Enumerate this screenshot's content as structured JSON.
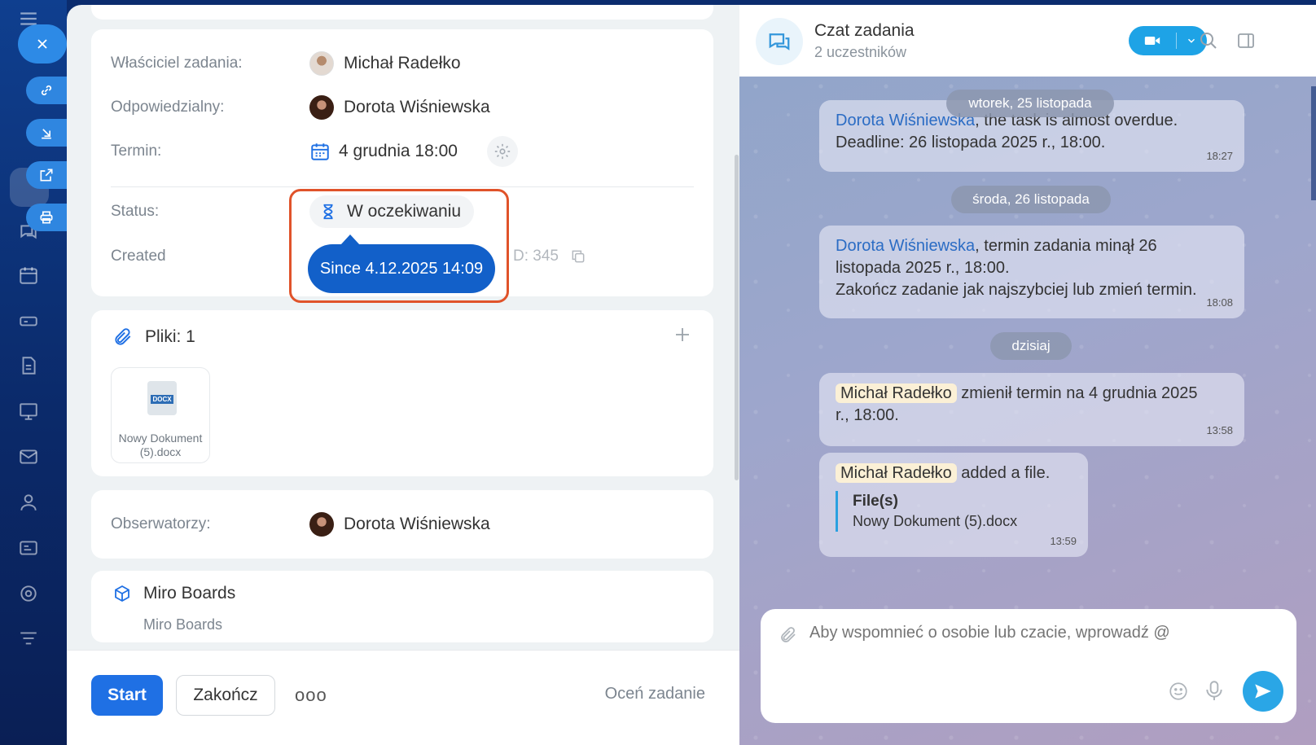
{
  "task": {
    "owner_label": "Właściciel zadania:",
    "owner_name": "Michał Radełko",
    "responsible_label": "Odpowiedzialny:",
    "responsible_name": "Dorota Wiśniewska",
    "deadline_label": "Termin:",
    "deadline_value": "4 grudnia 18:00",
    "status_label": "Status:",
    "status_value": "W oczekiwaniu",
    "created_label": "Created",
    "id_fragment": "D: 345",
    "tooltip": "Since 4.12.2025 14:09"
  },
  "files": {
    "title": "Pliki: 1",
    "items": [
      {
        "name": "Nowy Dokument (5).docx",
        "badge": "DOCX"
      }
    ]
  },
  "observers": {
    "label": "Obserwatorzy:",
    "name": "Dorota Wiśniewska"
  },
  "miro": {
    "title": "Miro Boards",
    "subtitle": "Miro Boards"
  },
  "actions": {
    "start": "Start",
    "finish": "Zakończ",
    "more": "ooo",
    "rate": "Oceń zadanie"
  },
  "chat": {
    "title": "Czat zadania",
    "subtitle": "2 uczestników",
    "dates": [
      "wtorek, 25 listopada",
      "środa, 26 listopada",
      "dzisiaj"
    ],
    "messages": [
      {
        "mention": "Dorota Wiśniewska",
        "text": ", the task is almost overdue.",
        "line2": "Deadline: 26 listopada 2025 r., 18:00.",
        "time": "18:27"
      },
      {
        "mention": "Dorota Wiśniewska",
        "text": ", termin zadania minął 26",
        "line2": "listopada 2025 r., 18:00.",
        "line3": "Zakończ zadanie jak najszybciej lub zmień termin.",
        "time": "18:08"
      },
      {
        "mention": "Michał Radełko",
        "text": " zmienił termin na 4 grudnia 2025",
        "line2": "r., 18:00.",
        "time": "13:58"
      },
      {
        "mention": "Michał Radełko",
        "text": " added a file.",
        "file_label": "File(s)",
        "file_name": "Nowy Dokument (5).docx",
        "time": "13:59"
      }
    ],
    "input_placeholder": "Aby wspomnieć o osobie lub czacie, wprowadź @"
  },
  "colors": {
    "primary": "#1f70e4",
    "tooltip": "#1260c9",
    "highlight": "#e0532a",
    "sidebar": "#0f3f8f"
  }
}
